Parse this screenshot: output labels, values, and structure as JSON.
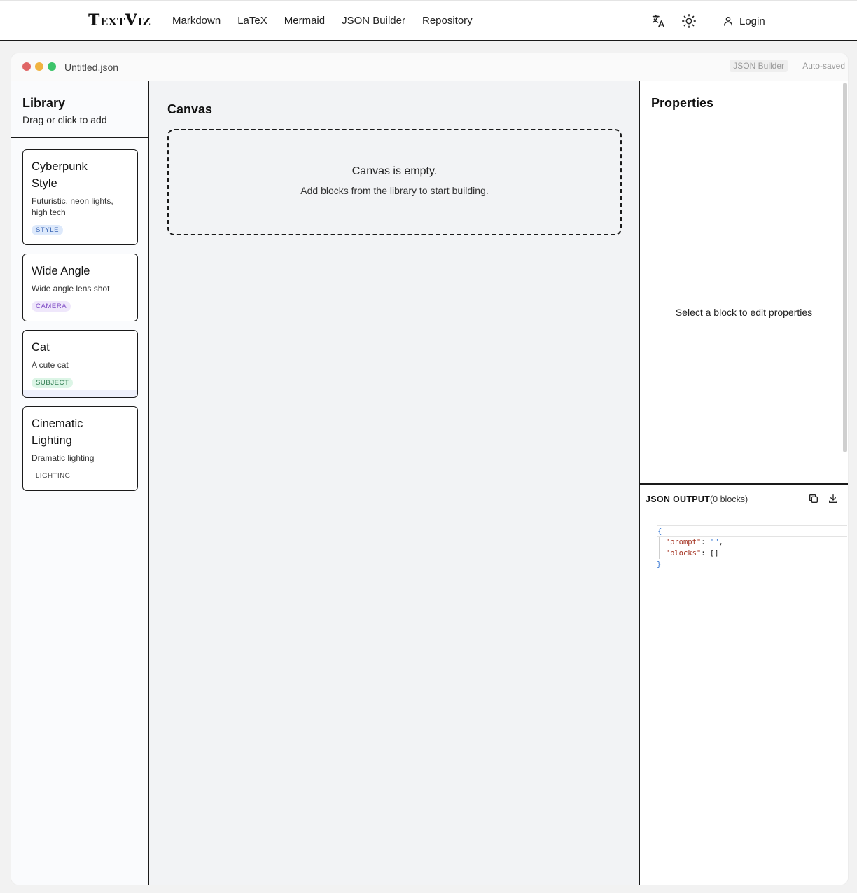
{
  "topbar": {
    "brand": "TextViz",
    "nav": [
      "Markdown",
      "LaTeX",
      "Mermaid",
      "JSON Builder",
      "Repository"
    ],
    "translate_icon": "translate-icon",
    "theme_icon": "sun-icon",
    "login_label": "Login"
  },
  "window": {
    "filename": "Untitled.json",
    "mode_badge": "JSON Builder",
    "status": "Auto-saved"
  },
  "library": {
    "title": "Library",
    "subtitle": "Drag or click to add",
    "cards": [
      {
        "title_lines": [
          "Cyberpunk",
          "Style"
        ],
        "description_lines": [
          "Futuristic, neon lights,",
          "high tech"
        ],
        "tag": "STYLE"
      },
      {
        "title_lines": [
          "Wide Angle"
        ],
        "description_lines": [
          "Wide angle lens shot"
        ],
        "tag": "CAMERA"
      },
      {
        "title_lines": [
          "Cat"
        ],
        "description_lines": [
          "A cute cat"
        ],
        "tag": "SUBJECT"
      },
      {
        "title_lines": [
          "Cinematic",
          "Lighting"
        ],
        "description_lines": [
          "Dramatic lighting"
        ],
        "tag": "LIGHTING"
      }
    ]
  },
  "canvas": {
    "title": "Canvas",
    "empty_title": "Canvas is empty.",
    "empty_subtitle": "Add blocks from the library to start building."
  },
  "properties": {
    "title": "Properties",
    "empty_text": "Select a block to edit properties"
  },
  "json_output": {
    "label": "JSON OUTPUT",
    "count": "(0 blocks)",
    "code": {
      "open": "{",
      "prompt_key": "\"prompt\"",
      "prompt_value": "\"\"",
      "blocks_key": "\"blocks\"",
      "blocks_value": "[]",
      "close": "}"
    }
  },
  "colors": {
    "accent_blue": "#2b6fd1",
    "tag_style": "#dde9fb",
    "tag_camera": "#efe7fb",
    "tag_subject": "#dcf5e6",
    "window_red": "#e06666",
    "window_yellow": "#f0b341",
    "window_green": "#3dc46a"
  }
}
